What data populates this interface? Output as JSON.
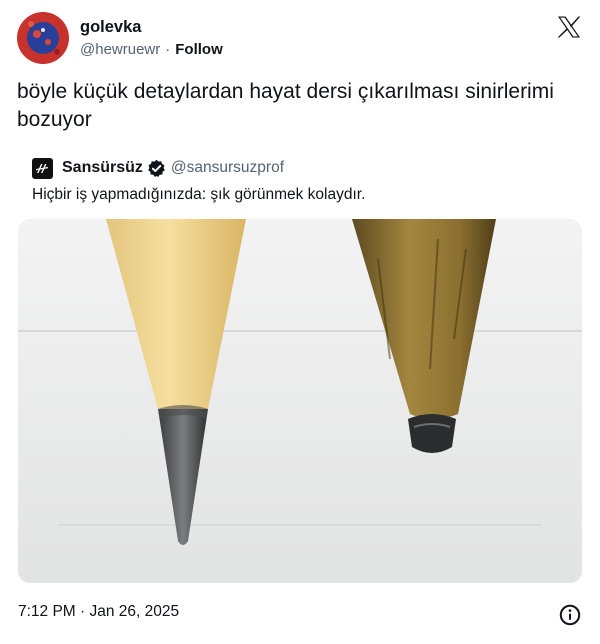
{
  "author": {
    "display_name": "golevka",
    "handle": "@hewruewr",
    "separator": "·",
    "follow_label": "Follow"
  },
  "tweet": {
    "text": "böyle küçük detaylardan hayat dersi çıkarılması sinirlerimi bozuyor"
  },
  "quoted": {
    "display_name": "Sansürsüz",
    "handle": "@sansursuzprof",
    "text": "Hiçbir iş yapmadığınızda: şık görünmek kolaydır."
  },
  "footer": {
    "timestamp": "7:12 PM · Jan 26, 2025"
  },
  "icons": {
    "platform": "x-logo-icon",
    "verified": "verified-badge-icon",
    "info": "info-icon"
  },
  "colors": {
    "text_primary": "#0f1419",
    "text_secondary": "#536471",
    "avatar_outer": "#c8322c",
    "avatar_inner": "#2a3f9a"
  }
}
